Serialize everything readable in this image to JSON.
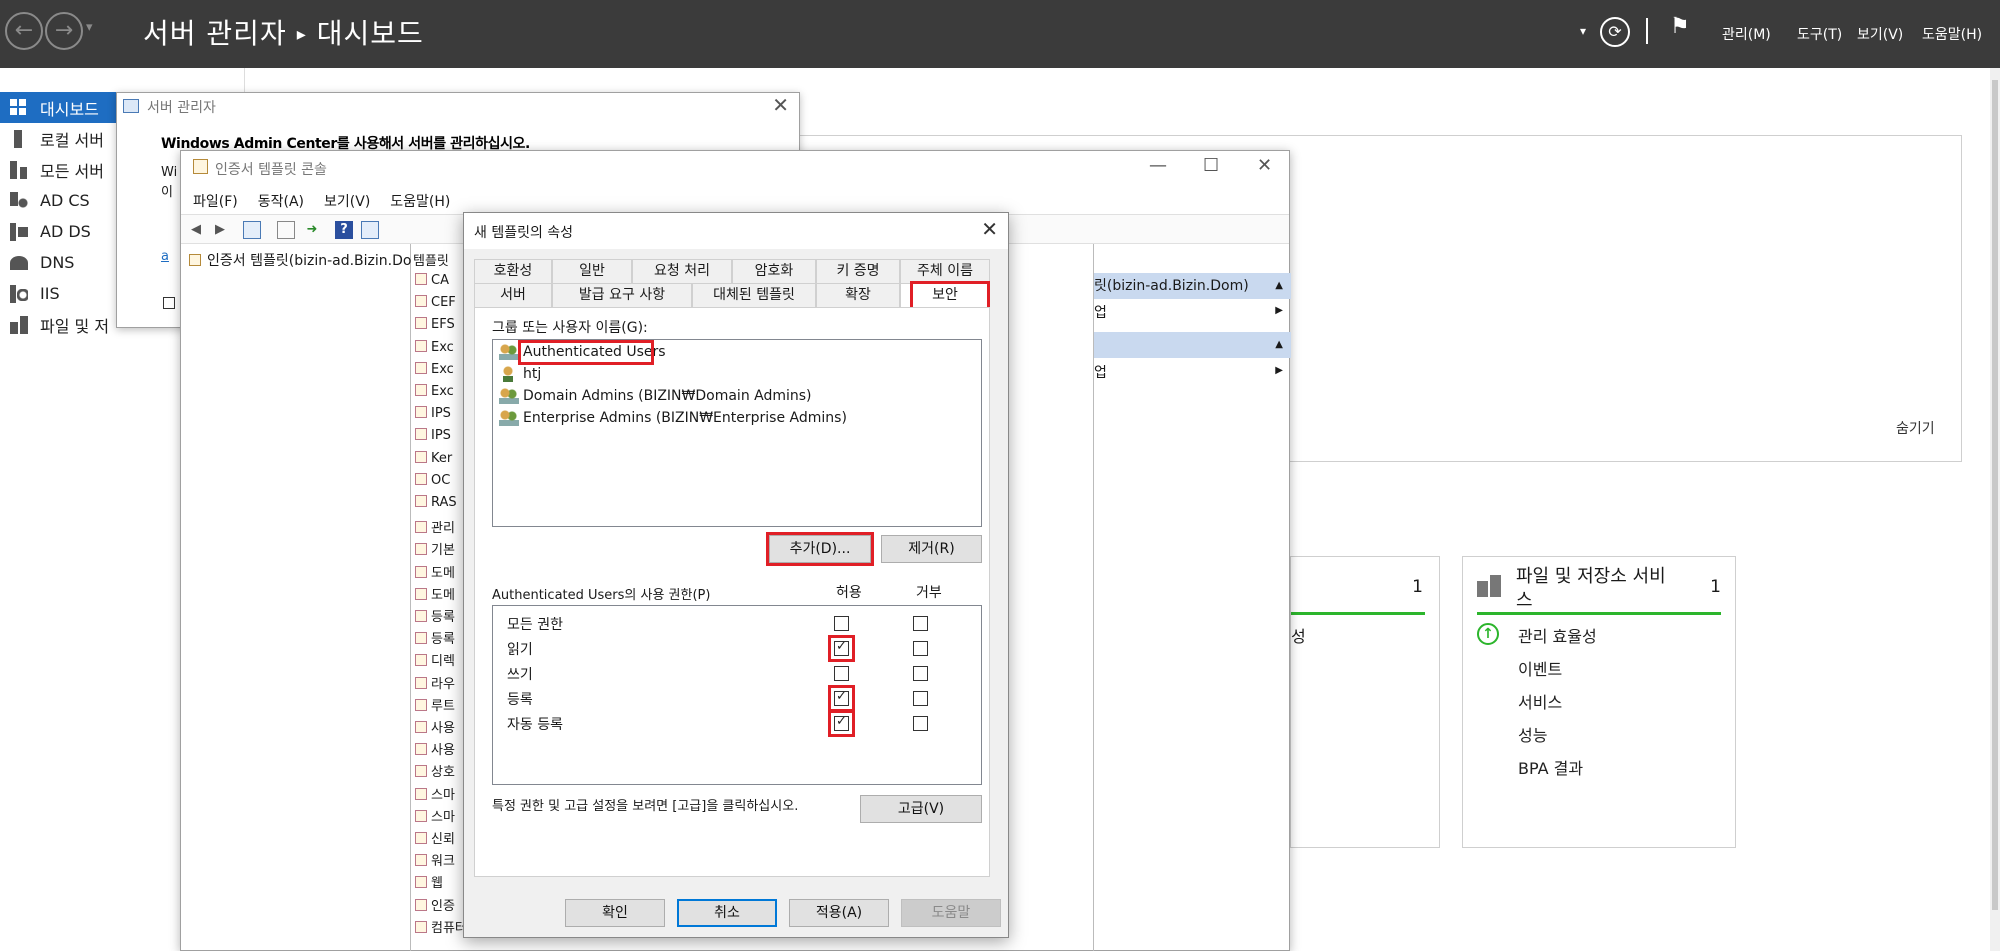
{
  "header": {
    "app_title": "서버 관리자",
    "separator": "▸",
    "page": "대시보드",
    "menu": [
      "관리(M)",
      "도구(T)",
      "보기(V)",
      "도움말(H)"
    ]
  },
  "leftnav": {
    "items": [
      {
        "label": "대시보드",
        "icon": "dashboard-icon"
      },
      {
        "label": "로컬 서버",
        "icon": "server-icon"
      },
      {
        "label": "모든 서버",
        "icon": "servers-icon"
      },
      {
        "label": "AD CS",
        "icon": "adcs-icon"
      },
      {
        "label": "AD DS",
        "icon": "adds-icon"
      },
      {
        "label": "DNS",
        "icon": "dns-icon"
      },
      {
        "label": "IIS",
        "icon": "iis-icon"
      },
      {
        "label": "파일 및 저",
        "icon": "storage-icon"
      }
    ]
  },
  "dashboard": {
    "hide_label": "숨기기",
    "tile_left": {
      "count": "1",
      "row1": "성"
    },
    "tile_right": {
      "title_line1": "파일 및 저장소 서비",
      "title_line2": "스",
      "count": "1",
      "rows": [
        "관리 효율성",
        "이벤트",
        "서비스",
        "성능",
        "BPA 결과"
      ]
    }
  },
  "sm_window": {
    "title": "서버 관리자",
    "headline": "Windows Admin Center를 사용해서 서버를 관리하십시오.",
    "frag1": "Wi",
    "frag2": "이",
    "frag3": "a"
  },
  "cert_console": {
    "title": "인증서 템플릿 콘솔",
    "menu": [
      "파일(F)",
      "동작(A)",
      "보기(V)",
      "도움말(H)"
    ],
    "tree_item": "인증서 템플릿(bizin-ad.Bizin.Dom)",
    "list_header": "템플릿",
    "list_items": [
      "CA",
      "CEF",
      "EFS",
      "Exc",
      "Exc",
      "Exc",
      "IPS",
      "IPS",
      "Ker",
      "OC",
      "RAS",
      "관리",
      "기본",
      "도메",
      "도메",
      "등록",
      "등록",
      "디렉",
      "라우",
      "루트",
      "사용",
      "사용",
      "상호",
      "스마",
      "스마",
      "신뢰",
      "워크",
      "웹",
      "인증",
      "컴퓨터"
    ],
    "action_header": "릿(bizin-ad.Bizin.Dom)",
    "action_row1": "업",
    "action_row2": "업"
  },
  "dialog": {
    "title": "새 템플릿의 속성",
    "tabs_row1": [
      "호환성",
      "일반",
      "요청 처리",
      "암호화",
      "키 증명",
      "주체 이름"
    ],
    "tabs_row2": [
      "서버",
      "발급 요구 사항",
      "대체된 템플릿",
      "확장",
      "보안"
    ],
    "group_label": "그룹 또는 사용자 이름(G):",
    "users": [
      {
        "name": "Authenticated Users",
        "icon": "group-icon"
      },
      {
        "name": "htj",
        "icon": "user-icon"
      },
      {
        "name": "Domain Admins (BIZIN₩Domain Admins)",
        "icon": "group-icon"
      },
      {
        "name": "Enterprise Admins (BIZIN₩Enterprise Admins)",
        "icon": "group-icon"
      }
    ],
    "add_button": "추가(D)...",
    "remove_button": "제거(R)",
    "perm_label": "Authenticated Users의 사용 권한(P)",
    "allow_label": "허용",
    "deny_label": "거부",
    "permissions": [
      {
        "name": "모든 권한",
        "allow": false,
        "deny": false
      },
      {
        "name": "읽기",
        "allow": true,
        "deny": false
      },
      {
        "name": "쓰기",
        "allow": false,
        "deny": false
      },
      {
        "name": "등록",
        "allow": true,
        "deny": false
      },
      {
        "name": "자동 등록",
        "allow": true,
        "deny": false
      }
    ],
    "advanced_hint": "특정 권한 및 고급 설정을 보려면 [고급]을 클릭하십시오.",
    "advanced_button": "고급(V)",
    "ok": "확인",
    "cancel": "취소",
    "apply": "적용(A)",
    "help": "도움말"
  },
  "colors": {
    "accent": "#1e6dc2",
    "highlight": "#e01f26",
    "status_green": "#2cb52c"
  }
}
